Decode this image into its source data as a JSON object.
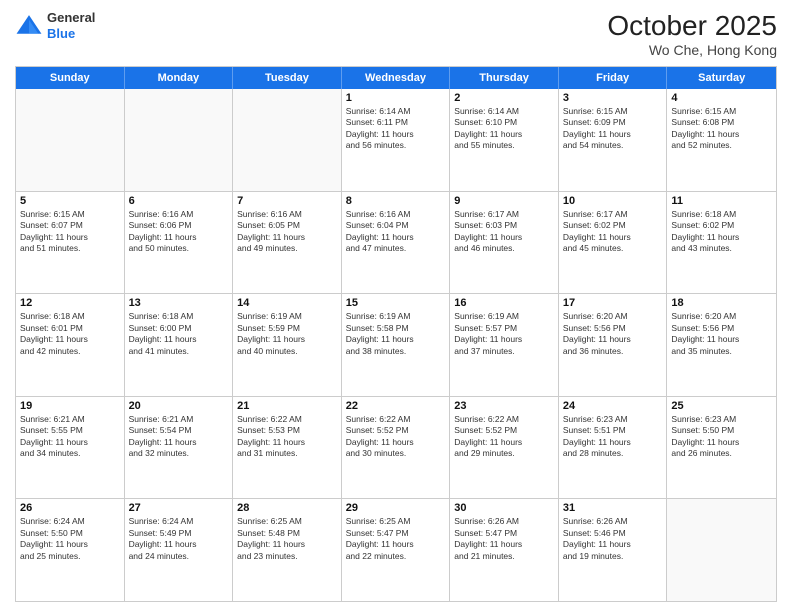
{
  "header": {
    "logo": {
      "line1": "General",
      "line2": "Blue"
    },
    "month": "October 2025",
    "location": "Wo Che, Hong Kong"
  },
  "days": [
    "Sunday",
    "Monday",
    "Tuesday",
    "Wednesday",
    "Thursday",
    "Friday",
    "Saturday"
  ],
  "weeks": [
    [
      {
        "day": "",
        "info": ""
      },
      {
        "day": "",
        "info": ""
      },
      {
        "day": "",
        "info": ""
      },
      {
        "day": "1",
        "info": "Sunrise: 6:14 AM\nSunset: 6:11 PM\nDaylight: 11 hours\nand 56 minutes."
      },
      {
        "day": "2",
        "info": "Sunrise: 6:14 AM\nSunset: 6:10 PM\nDaylight: 11 hours\nand 55 minutes."
      },
      {
        "day": "3",
        "info": "Sunrise: 6:15 AM\nSunset: 6:09 PM\nDaylight: 11 hours\nand 54 minutes."
      },
      {
        "day": "4",
        "info": "Sunrise: 6:15 AM\nSunset: 6:08 PM\nDaylight: 11 hours\nand 52 minutes."
      }
    ],
    [
      {
        "day": "5",
        "info": "Sunrise: 6:15 AM\nSunset: 6:07 PM\nDaylight: 11 hours\nand 51 minutes."
      },
      {
        "day": "6",
        "info": "Sunrise: 6:16 AM\nSunset: 6:06 PM\nDaylight: 11 hours\nand 50 minutes."
      },
      {
        "day": "7",
        "info": "Sunrise: 6:16 AM\nSunset: 6:05 PM\nDaylight: 11 hours\nand 49 minutes."
      },
      {
        "day": "8",
        "info": "Sunrise: 6:16 AM\nSunset: 6:04 PM\nDaylight: 11 hours\nand 47 minutes."
      },
      {
        "day": "9",
        "info": "Sunrise: 6:17 AM\nSunset: 6:03 PM\nDaylight: 11 hours\nand 46 minutes."
      },
      {
        "day": "10",
        "info": "Sunrise: 6:17 AM\nSunset: 6:02 PM\nDaylight: 11 hours\nand 45 minutes."
      },
      {
        "day": "11",
        "info": "Sunrise: 6:18 AM\nSunset: 6:02 PM\nDaylight: 11 hours\nand 43 minutes."
      }
    ],
    [
      {
        "day": "12",
        "info": "Sunrise: 6:18 AM\nSunset: 6:01 PM\nDaylight: 11 hours\nand 42 minutes."
      },
      {
        "day": "13",
        "info": "Sunrise: 6:18 AM\nSunset: 6:00 PM\nDaylight: 11 hours\nand 41 minutes."
      },
      {
        "day": "14",
        "info": "Sunrise: 6:19 AM\nSunset: 5:59 PM\nDaylight: 11 hours\nand 40 minutes."
      },
      {
        "day": "15",
        "info": "Sunrise: 6:19 AM\nSunset: 5:58 PM\nDaylight: 11 hours\nand 38 minutes."
      },
      {
        "day": "16",
        "info": "Sunrise: 6:19 AM\nSunset: 5:57 PM\nDaylight: 11 hours\nand 37 minutes."
      },
      {
        "day": "17",
        "info": "Sunrise: 6:20 AM\nSunset: 5:56 PM\nDaylight: 11 hours\nand 36 minutes."
      },
      {
        "day": "18",
        "info": "Sunrise: 6:20 AM\nSunset: 5:56 PM\nDaylight: 11 hours\nand 35 minutes."
      }
    ],
    [
      {
        "day": "19",
        "info": "Sunrise: 6:21 AM\nSunset: 5:55 PM\nDaylight: 11 hours\nand 34 minutes."
      },
      {
        "day": "20",
        "info": "Sunrise: 6:21 AM\nSunset: 5:54 PM\nDaylight: 11 hours\nand 32 minutes."
      },
      {
        "day": "21",
        "info": "Sunrise: 6:22 AM\nSunset: 5:53 PM\nDaylight: 11 hours\nand 31 minutes."
      },
      {
        "day": "22",
        "info": "Sunrise: 6:22 AM\nSunset: 5:52 PM\nDaylight: 11 hours\nand 30 minutes."
      },
      {
        "day": "23",
        "info": "Sunrise: 6:22 AM\nSunset: 5:52 PM\nDaylight: 11 hours\nand 29 minutes."
      },
      {
        "day": "24",
        "info": "Sunrise: 6:23 AM\nSunset: 5:51 PM\nDaylight: 11 hours\nand 28 minutes."
      },
      {
        "day": "25",
        "info": "Sunrise: 6:23 AM\nSunset: 5:50 PM\nDaylight: 11 hours\nand 26 minutes."
      }
    ],
    [
      {
        "day": "26",
        "info": "Sunrise: 6:24 AM\nSunset: 5:50 PM\nDaylight: 11 hours\nand 25 minutes."
      },
      {
        "day": "27",
        "info": "Sunrise: 6:24 AM\nSunset: 5:49 PM\nDaylight: 11 hours\nand 24 minutes."
      },
      {
        "day": "28",
        "info": "Sunrise: 6:25 AM\nSunset: 5:48 PM\nDaylight: 11 hours\nand 23 minutes."
      },
      {
        "day": "29",
        "info": "Sunrise: 6:25 AM\nSunset: 5:47 PM\nDaylight: 11 hours\nand 22 minutes."
      },
      {
        "day": "30",
        "info": "Sunrise: 6:26 AM\nSunset: 5:47 PM\nDaylight: 11 hours\nand 21 minutes."
      },
      {
        "day": "31",
        "info": "Sunrise: 6:26 AM\nSunset: 5:46 PM\nDaylight: 11 hours\nand 19 minutes."
      },
      {
        "day": "",
        "info": ""
      }
    ]
  ]
}
